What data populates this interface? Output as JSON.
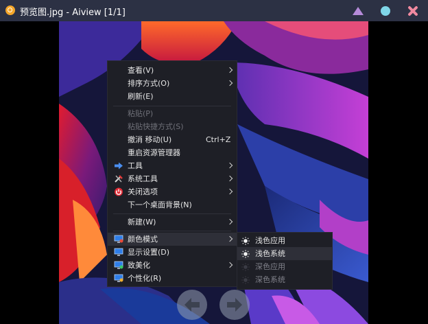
{
  "window": {
    "title": "预览图.jpg - Aiview [1/1]",
    "app_icon": "search-icon",
    "controls": [
      "minimize-triangle-icon",
      "maximize-circle-icon",
      "close-x-icon"
    ],
    "colors": {
      "titlebar": "#2c3144",
      "minimize": "#b68bd9",
      "maximize": "#7fd6e8",
      "close": "#f08aa0"
    }
  },
  "context_menu": {
    "items": [
      {
        "label": "查看(V)",
        "submenu": true
      },
      {
        "label": "排序方式(O)",
        "submenu": true
      },
      {
        "label": "刷新(E)"
      },
      {
        "label": "粘贴(P)",
        "disabled": true
      },
      {
        "label": "粘贴快捷方式(S)",
        "disabled": true
      },
      {
        "label": "撤消 移动(U)",
        "shortcut": "Ctrl+Z"
      },
      {
        "label": "重启资源管理器"
      },
      {
        "label": "工具",
        "submenu": true,
        "icon": "arrow-right-icon"
      },
      {
        "label": "系统工具",
        "submenu": true,
        "icon": "tools-icon"
      },
      {
        "label": "关闭选项",
        "submenu": true,
        "icon": "power-icon"
      },
      {
        "label": "下一个桌面背景(N)"
      },
      {
        "label": "新建(W)",
        "submenu": true
      },
      {
        "label": "颜色模式",
        "submenu": true,
        "icon": "monitor-icon",
        "highlighted": true
      },
      {
        "label": "显示设置(D)",
        "icon": "monitor-icon"
      },
      {
        "label": "致美化",
        "submenu": true,
        "icon": "monitor-icon"
      },
      {
        "label": "个性化(R)",
        "icon": "monitor-icon"
      }
    ]
  },
  "color_mode_submenu": {
    "items": [
      {
        "label": "浅色应用",
        "icon": "sun-icon"
      },
      {
        "label": "浅色系统",
        "icon": "sun-icon",
        "highlighted": true
      },
      {
        "label": "深色应用",
        "icon": "sun-icon",
        "dimmed": true
      },
      {
        "label": "深色系统",
        "icon": "sun-icon",
        "dimmed": true
      }
    ]
  },
  "navigation": {
    "prev_icon": "arrow-left-icon",
    "next_icon": "arrow-right-icon"
  }
}
